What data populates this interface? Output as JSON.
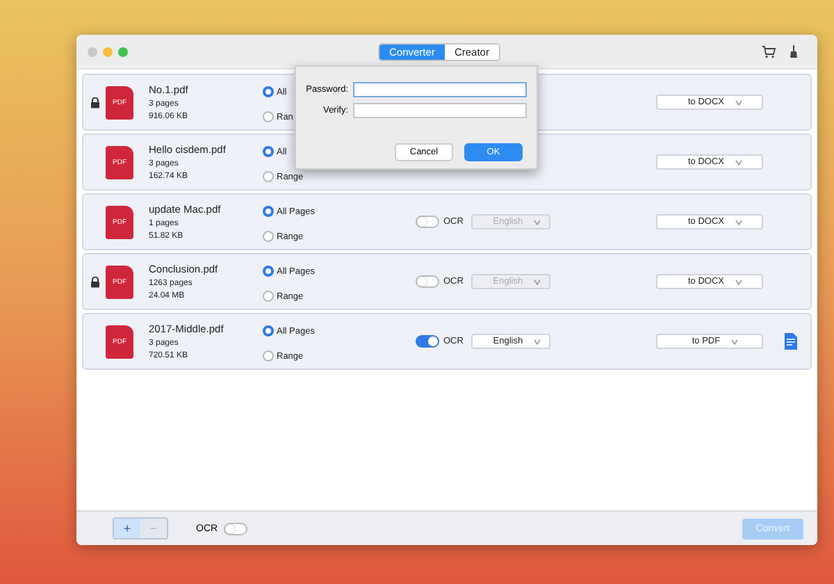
{
  "tabs": [
    {
      "label": "Converter",
      "selected": true
    },
    {
      "label": "Creator",
      "selected": false
    }
  ],
  "files": [
    {
      "name": "No.1.pdf",
      "pages": "3 pages",
      "size": "916.06 KB",
      "badge": "PDF",
      "locked": true,
      "options": [
        {
          "label": "All",
          "selected": true
        },
        {
          "label": "Ran",
          "selected": false
        }
      ],
      "format": "to DOCX",
      "done": false
    },
    {
      "name": "Hello cisdem.pdf",
      "pages": "3 pages",
      "size": "162.74 KB",
      "badge": "PDF",
      "locked": false,
      "options": [
        {
          "label": "All",
          "selected": true
        },
        {
          "label": "Range",
          "selected": false
        }
      ],
      "format": "to DOCX",
      "done": false
    },
    {
      "name": "update Mac.pdf",
      "pages": "1 pages",
      "size": "51.82 KB",
      "badge": "PDF",
      "locked": false,
      "options": [
        {
          "label": "All Pages",
          "selected": true
        },
        {
          "label": "Range",
          "selected": false
        }
      ],
      "ocr": {
        "label": "OCR",
        "on": false
      },
      "language": {
        "text": "English",
        "disabled": true
      },
      "format": "to DOCX",
      "done": false
    },
    {
      "name": "Conclusion.pdf",
      "pages": "1263 pages",
      "size": "24.04 MB",
      "badge": "PDF",
      "locked": true,
      "options": [
        {
          "label": "All Pages",
          "selected": true
        },
        {
          "label": "Range",
          "selected": false
        }
      ],
      "ocr": {
        "label": "OCR",
        "on": false
      },
      "language": {
        "text": "English",
        "disabled": true
      },
      "format": "to DOCX",
      "done": false
    },
    {
      "name": "2017-Middle.pdf",
      "pages": "3 pages",
      "size": "720.51 KB",
      "badge": "PDF",
      "locked": false,
      "options": [
        {
          "label": "All Pages",
          "selected": true
        },
        {
          "label": "Range",
          "selected": false
        }
      ],
      "ocr": {
        "label": "OCR",
        "on": true
      },
      "language": {
        "text": "English",
        "disabled": false
      },
      "format": "to PDF",
      "done": true
    }
  ],
  "password_dialog": {
    "fields": [
      {
        "label": "Password:",
        "focused": true
      },
      {
        "label": "Verify:",
        "focused": false
      }
    ],
    "buttons": [
      {
        "label": "Cancel",
        "kind": "secondary"
      },
      {
        "label": "OK",
        "kind": "primary"
      }
    ]
  },
  "bottom_bar": {
    "add": {
      "label": "+",
      "disabled": false
    },
    "remove": {
      "label": "−",
      "disabled": true
    },
    "ocr": {
      "label": "OCR",
      "on": false
    },
    "convert": {
      "label": "Convert",
      "disabled": true
    }
  }
}
